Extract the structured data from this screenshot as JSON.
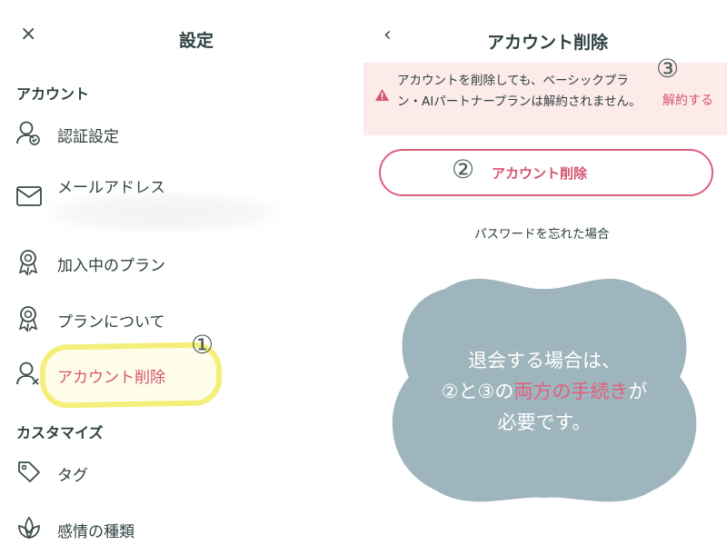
{
  "left": {
    "title": "設定",
    "close_icon": "close-icon",
    "sections": [
      {
        "label": "アカウント"
      },
      {
        "label": "カスタマイズ"
      }
    ],
    "items": {
      "auth": "認証設定",
      "email": "メールアドレス",
      "plan_current": "加入中のプラン",
      "plan_about": "プランについて",
      "delete_account": "アカウント削除",
      "tag": "タグ",
      "emotion": "感情の種類"
    },
    "annotation_1": "①"
  },
  "right": {
    "title": "アカウント削除",
    "back_icon": "chevron-left-icon",
    "warning": {
      "text": "アカウントを削除しても、ベーシックプラン・AIパートナープランは解約されません。",
      "link": "解約する",
      "annotation_3": "③"
    },
    "delete_button": {
      "label": "アカウント削除",
      "annotation_2": "②"
    },
    "forgot_password": "パスワードを忘れた場合",
    "overlay": {
      "line1": "退会する場合は、",
      "line2_prefix": "②と③の",
      "line2_highlight": "両方の手続き",
      "line2_suffix": "が",
      "line3": "必要です。"
    }
  },
  "colors": {
    "accent_danger": "#d4546f",
    "warning_bg": "#fdebea",
    "cloud": "#9fb5bd",
    "highlight_yellow": "#f4ef7a"
  }
}
